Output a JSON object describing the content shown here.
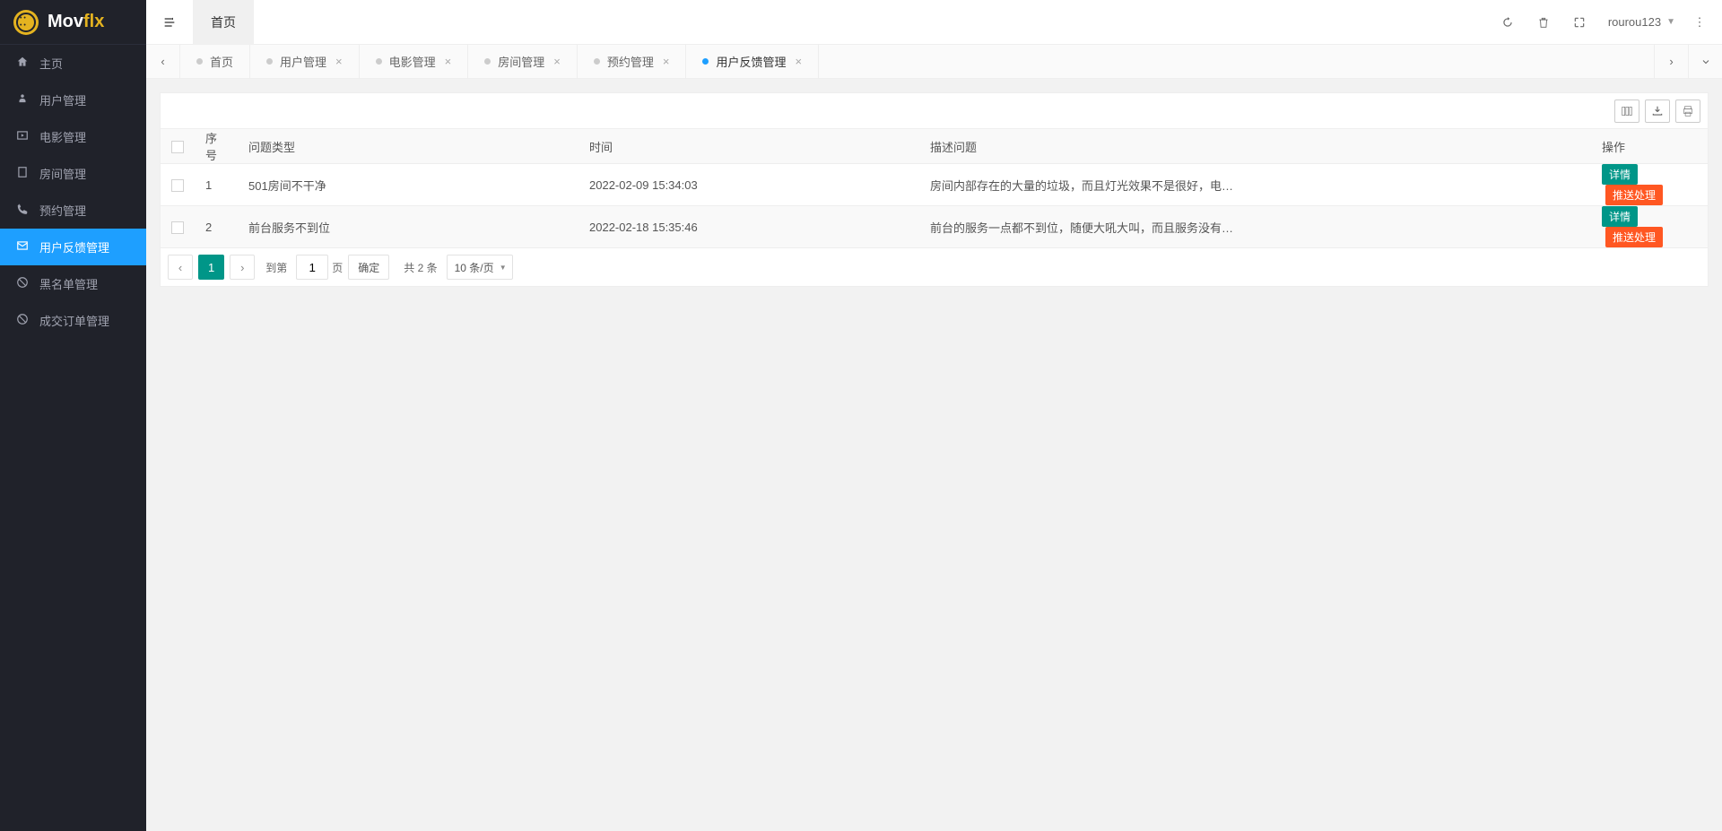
{
  "logo": {
    "text_main": "Mov",
    "text_accent": "flx"
  },
  "sidebar": {
    "items": [
      {
        "label": "主页",
        "icon": "home"
      },
      {
        "label": "用户管理",
        "icon": "user"
      },
      {
        "label": "电影管理",
        "icon": "play"
      },
      {
        "label": "房间管理",
        "icon": "room"
      },
      {
        "label": "预约管理",
        "icon": "phone"
      },
      {
        "label": "用户反馈管理",
        "icon": "mail",
        "active": true
      },
      {
        "label": "黑名单管理",
        "icon": "ban"
      },
      {
        "label": "成交订单管理",
        "icon": "ban"
      }
    ]
  },
  "header": {
    "tab": "首页",
    "username": "rourou123"
  },
  "tabs": [
    {
      "label": "首页",
      "closable": false
    },
    {
      "label": "用户管理",
      "closable": true
    },
    {
      "label": "电影管理",
      "closable": true
    },
    {
      "label": "房间管理",
      "closable": true
    },
    {
      "label": "预约管理",
      "closable": true
    },
    {
      "label": "用户反馈管理",
      "closable": true,
      "active": true
    }
  ],
  "table": {
    "headers": {
      "seq": "序号",
      "type": "问题类型",
      "time": "时间",
      "desc": "描述问题",
      "action": "操作"
    },
    "rows": [
      {
        "seq": "1",
        "type": "501房间不干净",
        "time": "2022-02-09 15:34:03",
        "desc": "房间内部存在的大量的垃圾，而且灯光效果不是很好，电影看的很…"
      },
      {
        "seq": "2",
        "type": "前台服务不到位",
        "time": "2022-02-18 15:35:46",
        "desc": "前台的服务一点都不到位，随便大吼大叫，而且服务没有一点耐心…"
      }
    ],
    "actions": {
      "detail": "详情",
      "push": "推送处理"
    }
  },
  "pager": {
    "current": "1",
    "goto_label": "到第",
    "goto_value": "1",
    "page_label": "页",
    "confirm": "确定",
    "total": "共 2 条",
    "per_page": "10 条/页"
  }
}
